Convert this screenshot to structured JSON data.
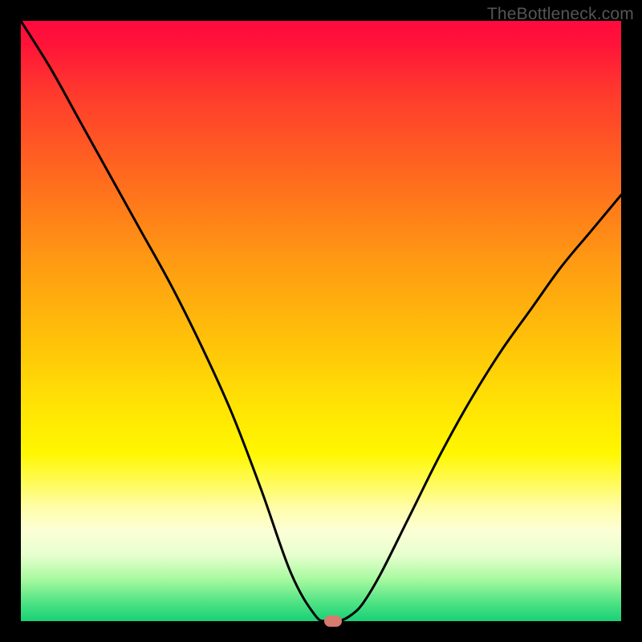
{
  "watermark": "TheBottleneck.com",
  "chart_data": {
    "type": "line",
    "title": "",
    "xlabel": "",
    "ylabel": "",
    "xlim": [
      0,
      100
    ],
    "ylim": [
      0,
      100
    ],
    "background_gradient": {
      "top": "#ff0a3f",
      "mid": "#fff700",
      "bottom": "#18d077"
    },
    "series": [
      {
        "name": "bottleneck-curve",
        "x": [
          0,
          5,
          10,
          15,
          20,
          25,
          30,
          35,
          40,
          45,
          49,
          51,
          53,
          55,
          57,
          60,
          65,
          70,
          75,
          80,
          85,
          90,
          95,
          100
        ],
        "values": [
          100,
          92,
          83,
          74,
          65,
          56,
          46,
          35,
          22,
          8,
          1,
          0,
          0,
          1,
          3,
          8,
          18,
          28,
          37,
          45,
          52,
          59,
          65,
          71
        ]
      }
    ],
    "marker": {
      "x": 52,
      "y": 0,
      "color": "#d77a6f"
    }
  }
}
